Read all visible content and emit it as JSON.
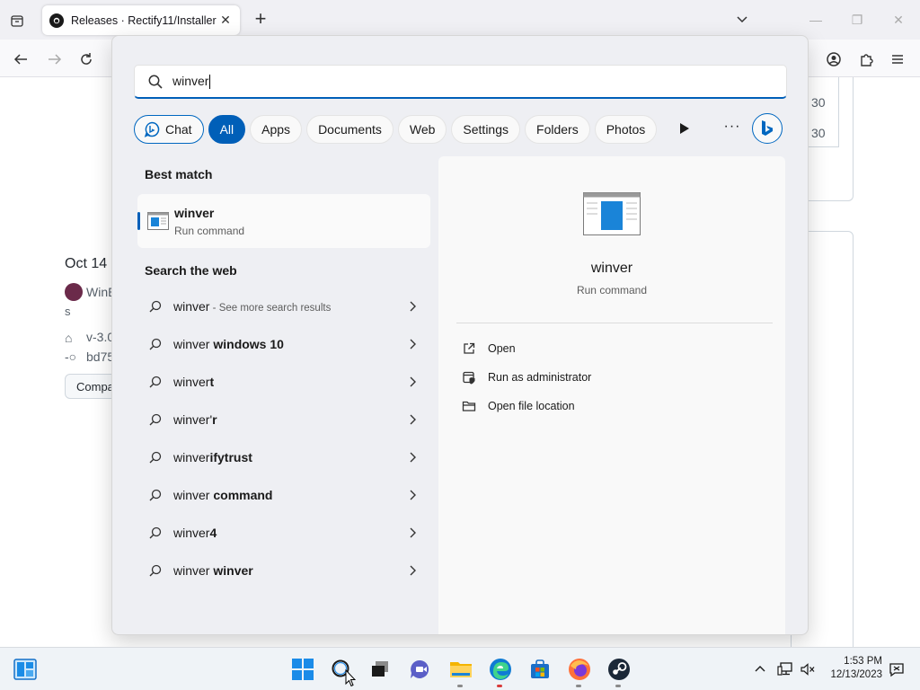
{
  "browser": {
    "tab_title": "Releases · Rectify11/Installer",
    "tab_close": "✕",
    "new_tab": "+"
  },
  "background_page": {
    "date": "Oct 14",
    "user": "WinE",
    "extra": "s",
    "tag": "v-3.0",
    "commit": "bd75",
    "compare_button": "Compa",
    "numbers": [
      "30",
      "30"
    ]
  },
  "search": {
    "query": "winver",
    "filters": [
      "Chat",
      "All",
      "Apps",
      "Documents",
      "Web",
      "Settings",
      "Folders",
      "Photos"
    ],
    "active_filter": "All",
    "more_label": "···"
  },
  "best_match": {
    "section_title": "Best match",
    "name": "winver",
    "type": "Run command"
  },
  "web": {
    "section_title": "Search the web",
    "results": [
      {
        "plain": "winver",
        "bold": "",
        "suffix": " - See more search results"
      },
      {
        "plain": "winver ",
        "bold": "windows 10",
        "suffix": ""
      },
      {
        "plain": "winver",
        "bold": "t",
        "suffix": ""
      },
      {
        "plain": "winver'",
        "bold": "r",
        "suffix": ""
      },
      {
        "plain": "winver",
        "bold": "ifytrust",
        "suffix": ""
      },
      {
        "plain": "winver ",
        "bold": "command",
        "suffix": ""
      },
      {
        "plain": "winver",
        "bold": "4",
        "suffix": ""
      },
      {
        "plain": "winver ",
        "bold": "winver",
        "suffix": ""
      }
    ]
  },
  "preview": {
    "name": "winver",
    "type": "Run command",
    "actions": [
      "Open",
      "Run as administrator",
      "Open file location"
    ]
  },
  "taskbar": {
    "time": "1:53 PM",
    "date": "12/13/2023"
  },
  "colors": {
    "accent": "#005fb8",
    "flyout_bg": "#eeeff3"
  }
}
